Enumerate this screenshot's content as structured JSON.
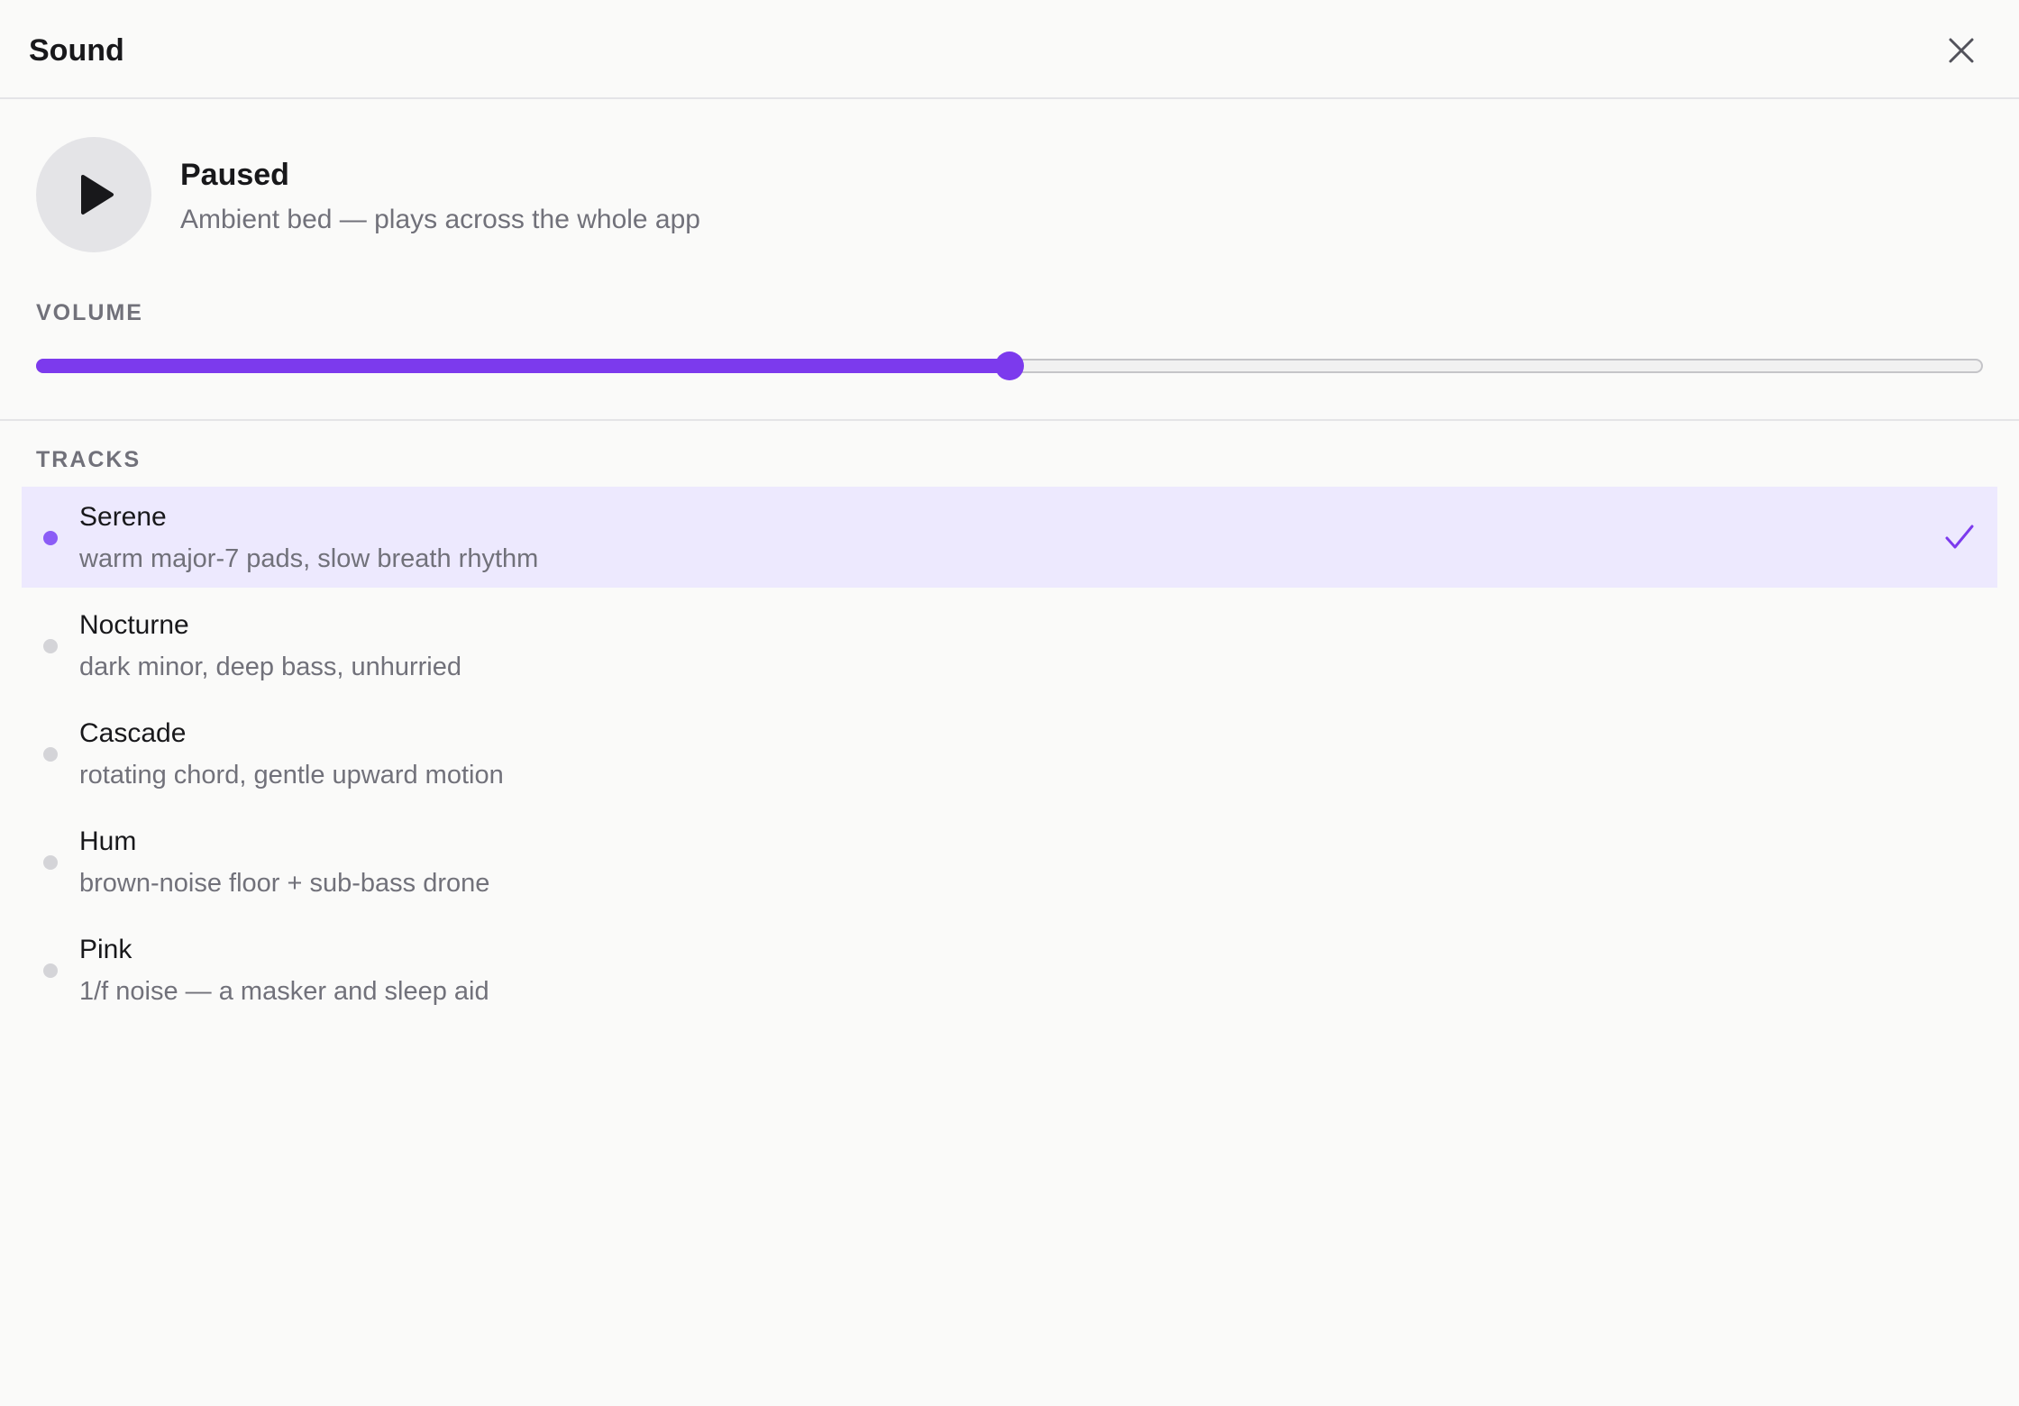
{
  "header": {
    "title": "Sound",
    "close_icon": "close-icon"
  },
  "player": {
    "status": "Paused",
    "description": "Ambient bed — plays across the whole app",
    "play_icon": "play-icon"
  },
  "volume": {
    "label": "VOLUME",
    "value_fraction": 0.5
  },
  "tracks": {
    "label": "TRACKS",
    "selected_index": 0,
    "items": [
      {
        "name": "Serene",
        "description": "warm major-7 pads, slow breath rhythm"
      },
      {
        "name": "Nocturne",
        "description": "dark minor, deep bass, unhurried"
      },
      {
        "name": "Cascade",
        "description": "rotating chord, gentle upward motion"
      },
      {
        "name": "Hum",
        "description": "brown-noise floor + sub-bass drone"
      },
      {
        "name": "Pink",
        "description": "1/f noise — a masker and sleep aid"
      }
    ]
  },
  "colors": {
    "accent": "#7c3aed",
    "selected_bg": "#ede9fe",
    "muted_text": "#71717a",
    "background": "#fafaf9"
  }
}
